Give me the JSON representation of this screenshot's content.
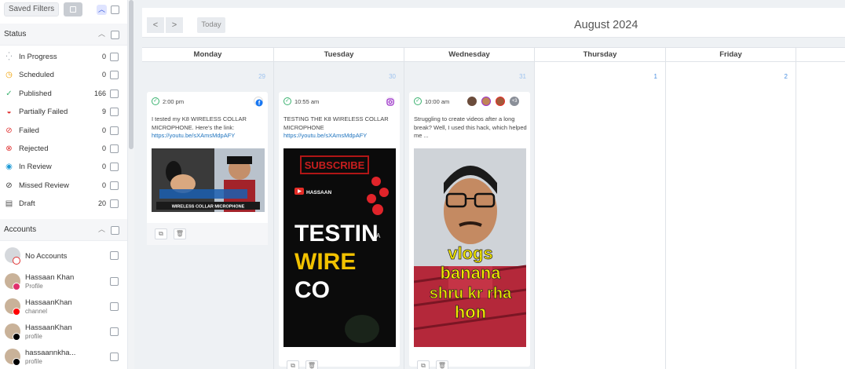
{
  "sidebar": {
    "saved_filters_label": "Saved Filters",
    "status_title": "Status",
    "status_items": [
      {
        "label": "In Progress",
        "count": "0",
        "icon": "spinner-icon",
        "color": "#9aa1aa"
      },
      {
        "label": "Scheduled",
        "count": "0",
        "icon": "clock-icon",
        "color": "#f0a000"
      },
      {
        "label": "Published",
        "count": "166",
        "icon": "check-circle-icon",
        "color": "#3cb371"
      },
      {
        "label": "Partially Failed",
        "count": "9",
        "icon": "half-circle-icon",
        "color": "#e03131"
      },
      {
        "label": "Failed",
        "count": "0",
        "icon": "ban-icon",
        "color": "#e03131"
      },
      {
        "label": "Rejected",
        "count": "0",
        "icon": "rejected-icon",
        "color": "#e03131"
      },
      {
        "label": "In Review",
        "count": "0",
        "icon": "eye-icon",
        "color": "#1c9ad6"
      },
      {
        "label": "Missed Review",
        "count": "0",
        "icon": "eye-slash-icon",
        "color": "#333333"
      },
      {
        "label": "Draft",
        "count": "20",
        "icon": "draft-icon",
        "color": "#555555"
      }
    ],
    "accounts_title": "Accounts",
    "accounts": [
      {
        "name": "No Accounts",
        "sub": "",
        "badge_color": "#e03131"
      },
      {
        "name": "Hassaan Khan",
        "sub": "Profile",
        "badge_color": "#e1306c"
      },
      {
        "name": "HassaanKhan",
        "sub": "channel",
        "badge_color": "#ff0000"
      },
      {
        "name": "HassaanKhan",
        "sub": "profile",
        "badge_color": "#000000"
      },
      {
        "name": "hassaannkha...",
        "sub": "profile",
        "badge_color": "#000000"
      }
    ]
  },
  "topbar": {
    "prev_label": "<",
    "next_label": ">",
    "today_label": "Today",
    "month_title": "August 2024"
  },
  "calendar": {
    "days": [
      {
        "name": "Monday",
        "num": "29"
      },
      {
        "name": "Tuesday",
        "num": "30"
      },
      {
        "name": "Wednesday",
        "num": "31"
      },
      {
        "name": "Thursday",
        "num": "1"
      },
      {
        "name": "Friday",
        "num": "2"
      }
    ],
    "posts": {
      "monday": {
        "time": "2:00 pm",
        "text": "I tested my K8 WIRELESS COLLAR MICROPHONE. Here's the link:",
        "link": "https://youtu.be/sXAmsMdpAFY",
        "thumb_caption": "WIRELESS COLLAR MICROPHONE"
      },
      "tuesday": {
        "time": "10:55 am",
        "text": "TESTING THE K8 WIRELESS COLLAR MICROPHONE",
        "link": "https://youtu.be/sXAmsMdpAFY",
        "thumb_subscribe": "SUBSCRIBE",
        "thumb_channel": "HASSAAN",
        "thumb_line1": "TESTIN",
        "thumb_a": "A",
        "thumb_line2": "WIRE",
        "thumb_line3": "CO"
      },
      "wednesday": {
        "time": "10:00 am",
        "text": "Struggling to create videos after a long break? Well, I used this hack, which helped me ...",
        "more_count": "+3",
        "thumb_line1": "vlogs",
        "thumb_line2": "banana",
        "thumb_line3": "shru kr rha",
        "thumb_line4": "hon"
      }
    }
  }
}
